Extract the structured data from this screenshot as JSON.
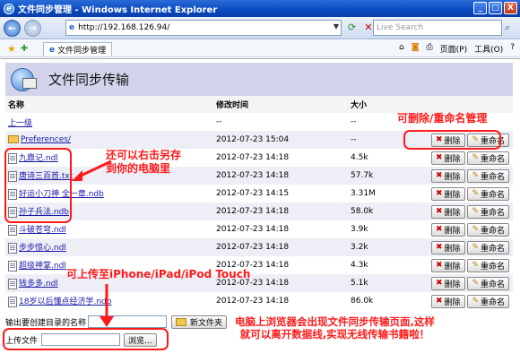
{
  "window": {
    "title": "文件同步管理 - Windows Internet Explorer",
    "btn_min": "_",
    "btn_max": "□",
    "btn_close": "X"
  },
  "nav": {
    "url": "http://192.168.126.94/",
    "search_placeholder": "Live Search",
    "back": "←",
    "forward": "→"
  },
  "favbar": {
    "tab_title": "文件同步管理",
    "page_label": "页面(P)",
    "tools_label": "工具(O)",
    "help_label": "?"
  },
  "page": {
    "heading": "文件同步传输",
    "col_name": "名称",
    "col_time": "修改时间",
    "col_size": "大小",
    "delete_label": "删除",
    "rename_label": "重命名",
    "rows": [
      {
        "name": "上一级",
        "time": "--",
        "size": "--",
        "type": "up"
      },
      {
        "name": "Preferences/",
        "time": "2012-07-23 15:04",
        "size": "--",
        "type": "folder"
      },
      {
        "name": "九鼎记.ndl",
        "time": "2012-07-23 14:18",
        "size": "4.5k",
        "type": "file"
      },
      {
        "name": "唐诗三百首.txt",
        "time": "2012-07-23 14:18",
        "size": "57.7k",
        "type": "file"
      },
      {
        "name": "好运小刀神 全一章.ndb",
        "time": "2012-07-23 14:15",
        "size": "3.31M",
        "type": "file"
      },
      {
        "name": "孙子兵法.ndb",
        "time": "2012-07-23 14:18",
        "size": "58.0k",
        "type": "file"
      },
      {
        "name": "斗破苍穹.ndl",
        "time": "2012-07-23 14:18",
        "size": "3.9k",
        "type": "file"
      },
      {
        "name": "步步惊心.ndl",
        "time": "2012-07-23 14:18",
        "size": "3.2k",
        "type": "file"
      },
      {
        "name": "超级神掌.ndl",
        "time": "2012-07-23 14:18",
        "size": "4.3k",
        "type": "file"
      },
      {
        "name": "钱多多.ndl",
        "time": "2012-07-23 14:18",
        "size": "5.1k",
        "type": "file"
      },
      {
        "name": "18岁以后懂点经济学.ndb",
        "time": "2012-07-23 14:18",
        "size": "86.0k",
        "type": "file"
      }
    ],
    "mkdir_label": "输出要创建目录的名称",
    "mkdir_button": "新文件夹",
    "upload_label": "上传文件",
    "browse_button": "浏览..."
  },
  "annotations": {
    "manage": "可删除/重命名管理",
    "save": "还可以右击另存\n到你的电脑里",
    "upload": "可上传至iPhone/iPad/iPod Touch",
    "bottom": "电脑上浏览器会出现文件同步传输页面,这样\n就可以离开数据线,实现无线传输书籍啦！"
  }
}
